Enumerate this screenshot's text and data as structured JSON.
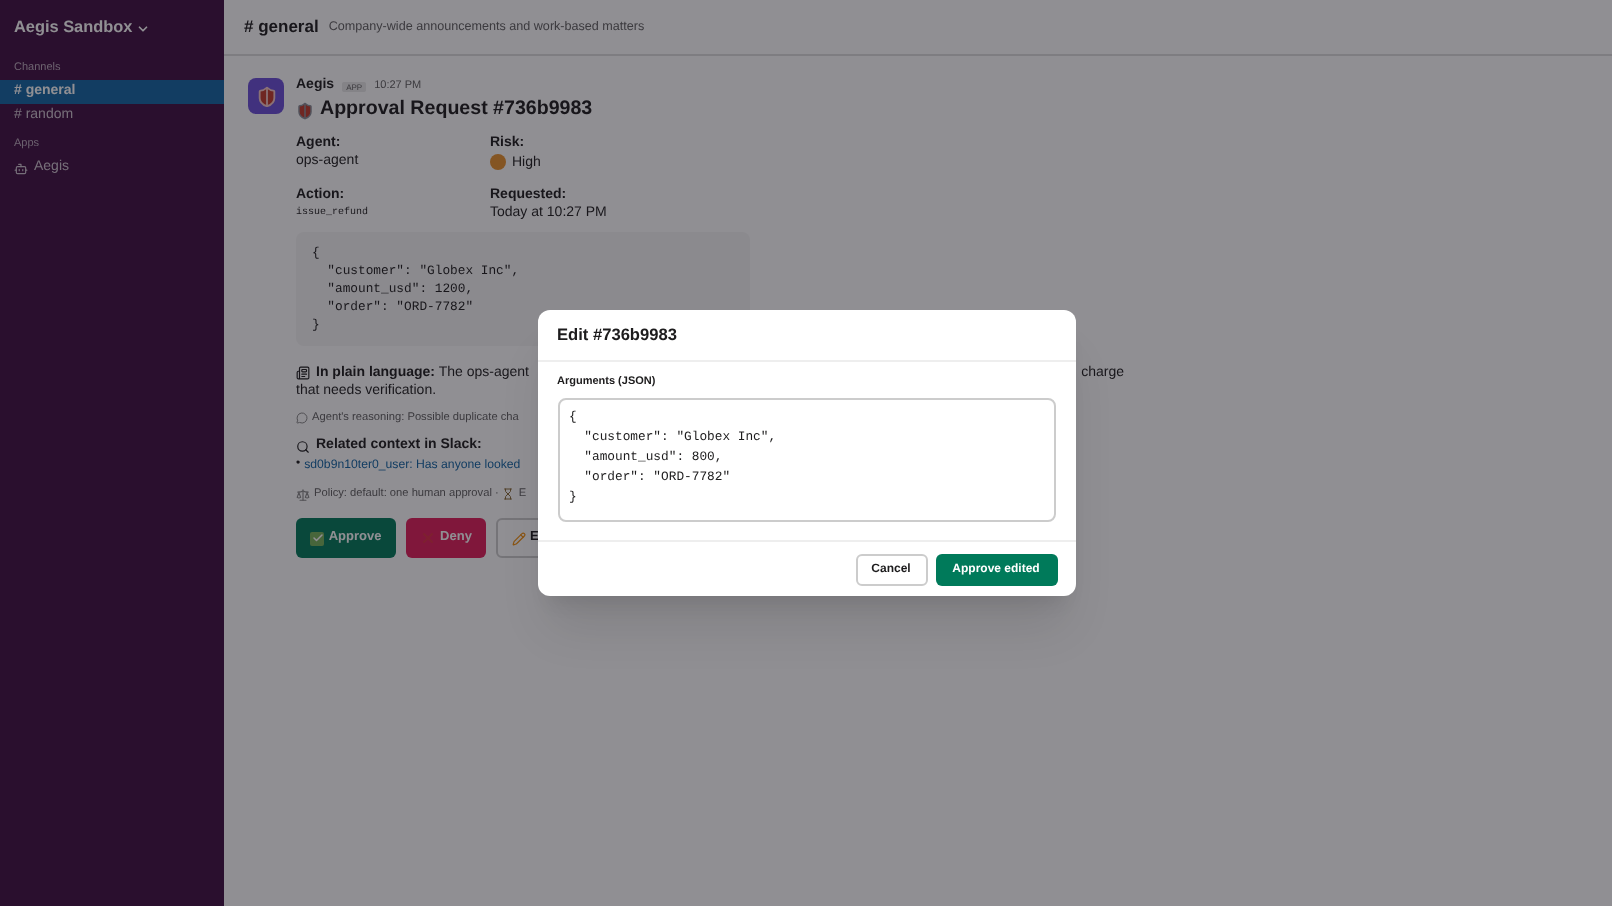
{
  "workspace": {
    "name": "Aegis Sandbox"
  },
  "sidebar": {
    "sections": [
      {
        "title": "Channels",
        "kind": "channels",
        "items": [
          {
            "label": "# general",
            "selected": true
          },
          {
            "label": "# random",
            "selected": false
          }
        ]
      },
      {
        "title": "Apps",
        "kind": "apps",
        "items": [
          {
            "label": "Aegis",
            "selected": false
          }
        ]
      }
    ]
  },
  "channel": {
    "name": "# general",
    "topic": "Company-wide announcements and work-based matters"
  },
  "message": {
    "sender": "Aegis",
    "badge": "APP",
    "time": "10:27 PM",
    "title": "Approval Request #736b9983",
    "fields": [
      {
        "label": "Agent:",
        "value": "ops-agent",
        "kind": "text"
      },
      {
        "label": "Risk:",
        "value": "High",
        "kind": "risk"
      },
      {
        "label": "Action:",
        "value": "issue_refund",
        "kind": "code"
      },
      {
        "label": "Requested:",
        "value": "Today at 10:27 PM",
        "kind": "text"
      }
    ],
    "code": "{\n  \"customer\": \"Globex Inc\",\n  \"amount_usd\": 1200,\n  \"order\": \"ORD-7782\"\n}",
    "plain_language": {
      "label": "In plain language:",
      "text_visible": "The ops-agent",
      "text_right": "charge",
      "text_line2": "that needs verification."
    },
    "reasoning": "Agent's reasoning: Possible duplicate cha",
    "related": {
      "label": "Related context in Slack:",
      "bullet": "•",
      "link": "sd0b9n10ter0_user: Has anyone looked"
    },
    "policy": {
      "text": "Policy: default: one human approval ·",
      "after": "E"
    },
    "buttons": [
      {
        "label": "Approve",
        "kind": "approve"
      },
      {
        "label": "Deny",
        "kind": "deny"
      },
      {
        "label": "E",
        "kind": "edit"
      }
    ]
  },
  "modal": {
    "title": "Edit #736b9983",
    "field_label": "Arguments (JSON)",
    "value": "{\n  \"customer\": \"Globex Inc\",\n  \"amount_usd\": 800,\n  \"order\": \"ORD-7782\"\n}",
    "buttons": [
      {
        "label": "Cancel",
        "kind": "secondary"
      },
      {
        "label": "Approve edited",
        "kind": "primary"
      }
    ]
  }
}
